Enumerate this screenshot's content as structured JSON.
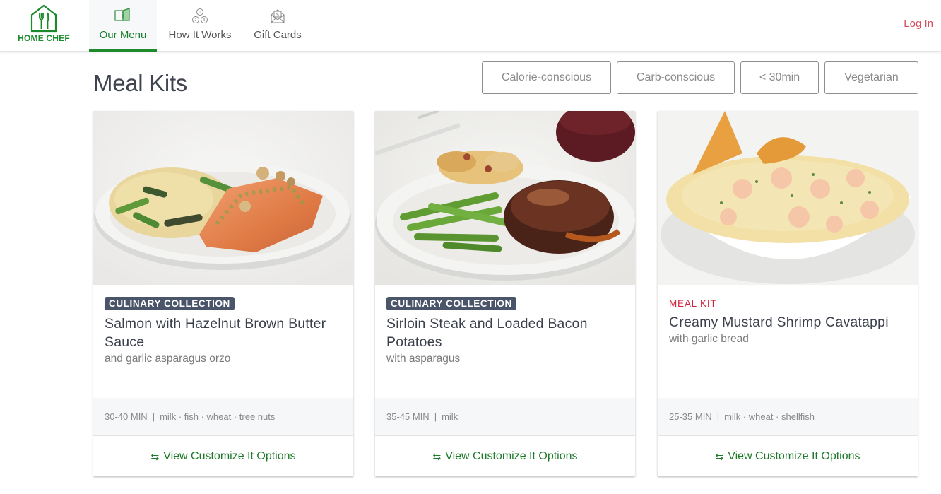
{
  "brand": {
    "name": "HOME CHEF",
    "color": "#1a8a2a"
  },
  "nav": {
    "items": [
      {
        "label": "Our Menu",
        "icon": "menu-book-icon",
        "active": true
      },
      {
        "label": "How It Works",
        "icon": "steps-icon",
        "active": false
      },
      {
        "label": "Gift Cards",
        "icon": "gift-envelope-icon",
        "active": false
      }
    ],
    "login_label": "Log In"
  },
  "page": {
    "title": "Meal Kits"
  },
  "filters": [
    "Calorie-conscious",
    "Carb-conscious",
    "< 30min",
    "Vegetarian"
  ],
  "cards": [
    {
      "badge": "CULINARY COLLECTION",
      "badge_style": "dark",
      "title": "Salmon with Hazelnut Brown Butter Sauce",
      "subtitle": "and garlic asparagus orzo",
      "time": "30-40 MIN",
      "allergens": "milk · fish · wheat · tree nuts",
      "cta": "View Customize It Options",
      "image_alt": "salmon-dish-photo"
    },
    {
      "badge": "CULINARY COLLECTION",
      "badge_style": "dark",
      "title": "Sirloin Steak and Loaded Bacon Potatoes",
      "subtitle": "with asparagus",
      "time": "35-45 MIN",
      "allergens": "milk",
      "cta": "View Customize It Options",
      "image_alt": "steak-dish-photo"
    },
    {
      "badge": "MEAL KIT",
      "badge_style": "red",
      "title": "Creamy Mustard Shrimp Cavatappi",
      "subtitle": "with garlic bread",
      "time": "25-35 MIN",
      "allergens": "milk · wheat · shellfish",
      "cta": "View Customize It Options",
      "image_alt": "shrimp-pasta-photo"
    }
  ],
  "meta_separator": "|",
  "cta_icon": "⇆"
}
